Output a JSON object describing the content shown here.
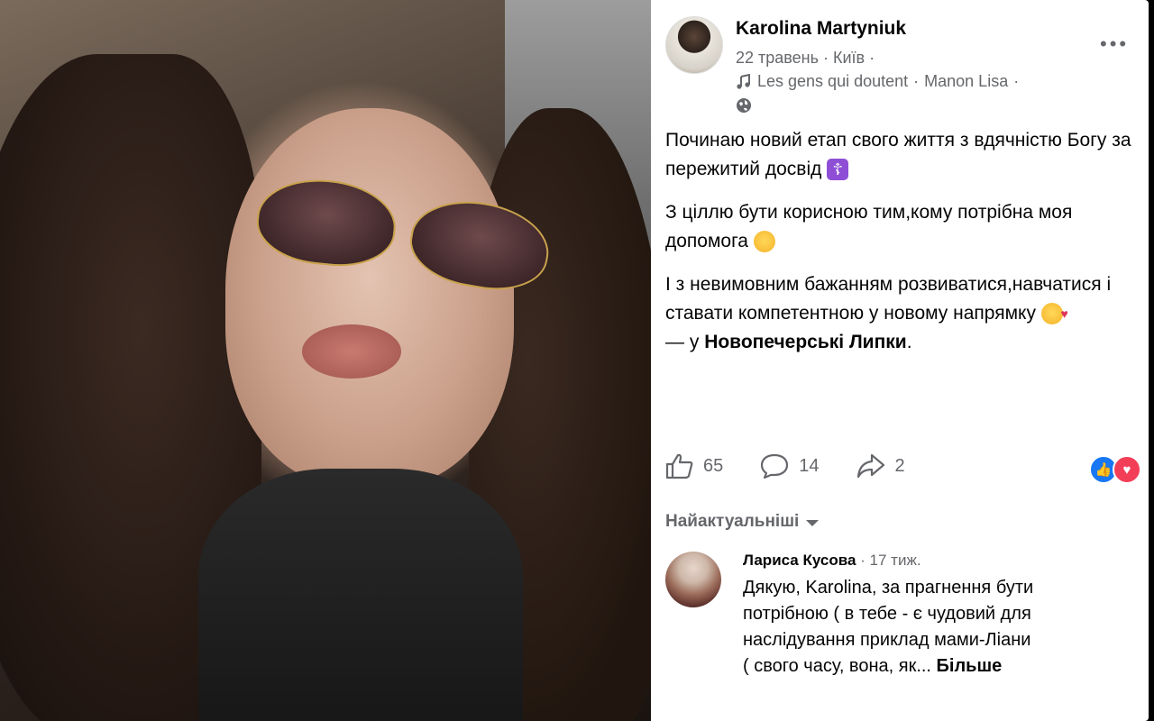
{
  "post": {
    "author": "Karolina Martyniuk",
    "date": "22 травень",
    "city": "Київ",
    "song": "Les gens qui doutent",
    "artist": "Manon Lisa",
    "paragraphs": [
      "Починаю новий етап свого життя з вдячністю Богу за пережитий досвід",
      "З ціллю бути корисною тим,кому потрібна моя допомога",
      "І з невимовним бажанням розвиватися,навчатися і ставати компетентною у новому напрямку"
    ],
    "location_prefix": "— у",
    "location": "Новопечерські Липки"
  },
  "actions": {
    "likes": "65",
    "comments": "14",
    "shares": "2"
  },
  "comments_sort": "Найактуальніші",
  "comment": {
    "author": "Лариса Кусова",
    "time": "17 тиж.",
    "text": "Дякую, Karolina, за прагнення бути потрібною ( в тебе - є чудовий для наслідування приклад мами-Ліани ( свого часу, вона, як...",
    "more": "Більше"
  },
  "icons": [
    "music-note-icon",
    "globe-icon",
    "more-dots-icon",
    "like-icon",
    "comment-icon",
    "share-icon",
    "reaction-like-icon",
    "reaction-heart-icon",
    "caret-down-icon"
  ],
  "colors": {
    "text": "#050505",
    "secondary": "#65676b",
    "like": "#1877f2",
    "heart": "#f33e58"
  }
}
